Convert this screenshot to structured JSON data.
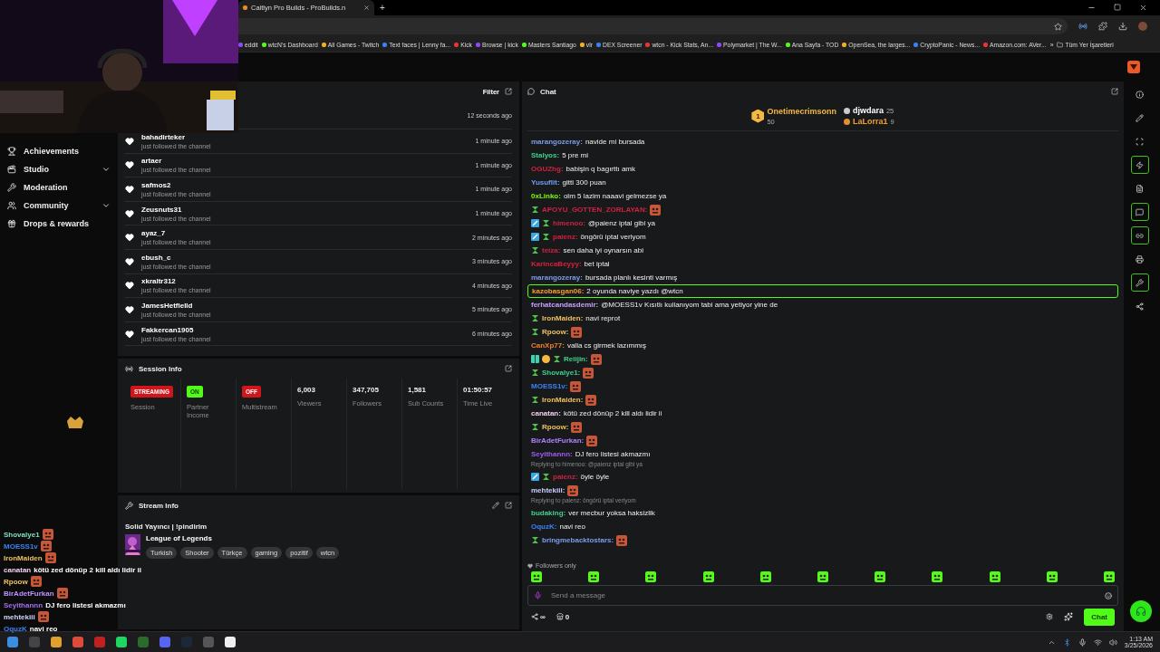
{
  "browser": {
    "tab_title": "Caitlyn Pro Builds - ProBuilds.n",
    "new_tab": "+",
    "bookmarks": [
      "eddit",
      "wtcN's Dashboard",
      "All Games - Twitch",
      "Text faces | Lenny fa...",
      "Kick",
      "Browse | kick",
      "Masters Santiago",
      "vlr",
      "DEX Screener",
      "wtcn - Kick Stats, An...",
      "Polymarket | The W...",
      "Ana Sayfa - TOD",
      "OpenSea, the larges...",
      "CryptoPanic - News...",
      "Amazon.com: AVer..."
    ],
    "more": "»",
    "all_bookmarks": "Tüm Yer İşaretleri"
  },
  "sidebar": {
    "items": [
      {
        "label": "Achievements",
        "expandable": false
      },
      {
        "label": "Studio",
        "expandable": true
      },
      {
        "label": "Moderation",
        "expandable": false
      },
      {
        "label": "Community",
        "expandable": true
      },
      {
        "label": "Drops & rewards",
        "expandable": false
      }
    ]
  },
  "stream_overlay_chat": [
    {
      "name": "Shovalye1",
      "color": "#7fe0c0",
      "emote": true
    },
    {
      "name": "MOESS1v",
      "color": "#3b82f6",
      "emote": true
    },
    {
      "name": "IronMaiden",
      "color": "#f0c060",
      "emote": true
    },
    {
      "name": "canatan",
      "color": "#f0d0f0",
      "text": "kötü zed dönüp 2 kill aldı lidir ii"
    },
    {
      "name": "Rpoow",
      "color": "#f0c060",
      "emote": true
    },
    {
      "name": "BirAdetFurkan",
      "color": "#c090ff",
      "emote": true
    },
    {
      "name": "Seyithannn",
      "color": "#a070f0",
      "text": "DJ fero listesi akmazmı"
    },
    {
      "name": "mehtekiii",
      "color": "#d0d8ff",
      "emote": true
    },
    {
      "name": "OquzK",
      "color": "#3b82f6",
      "text": "navi reo"
    }
  ],
  "activity": {
    "filter": "Filter",
    "latest_time": "12 seconds ago",
    "items": [
      {
        "name": "bahadirteker",
        "action": "just followed the channel",
        "time": "1 minute ago"
      },
      {
        "name": "artaer",
        "action": "just followed the channel",
        "time": "1 minute ago"
      },
      {
        "name": "safmos2",
        "action": "just followed the channel",
        "time": "1 minute ago"
      },
      {
        "name": "Zeusnuts31",
        "action": "just followed the channel",
        "time": "1 minute ago"
      },
      {
        "name": "ayaz_7",
        "action": "just followed the channel",
        "time": "2 minutes ago"
      },
      {
        "name": "ebush_c",
        "action": "just followed the channel",
        "time": "3 minutes ago"
      },
      {
        "name": "xkraltr312",
        "action": "just followed the channel",
        "time": "4 minutes ago"
      },
      {
        "name": "JamesHetfielld",
        "action": "just followed the channel",
        "time": "5 minutes ago"
      },
      {
        "name": "Fakkercan1905",
        "action": "just followed the channel",
        "time": "6 minutes ago"
      }
    ]
  },
  "session_info": {
    "title": "Session Info",
    "stats": [
      {
        "kind": "badge",
        "value": "STREAMING",
        "color": "#d0161b",
        "label": "Session"
      },
      {
        "kind": "badge",
        "value": "ON",
        "color": "#53fc18",
        "label": "Partner Income"
      },
      {
        "kind": "badge",
        "value": "OFF",
        "color": "#d0161b",
        "label": "Multistream"
      },
      {
        "kind": "number",
        "value": "6,003",
        "label": "Viewers"
      },
      {
        "kind": "number",
        "value": "347,705",
        "label": "Followers"
      },
      {
        "kind": "number",
        "value": "1,581",
        "label": "Sub Counts"
      },
      {
        "kind": "number",
        "value": "01:50:57",
        "label": "Time Live"
      }
    ]
  },
  "stream_info": {
    "title": "Stream Info",
    "stream_title": "Solid Yayıncı | !pindirim",
    "category": "League of Legends",
    "tags": [
      "Turkish",
      "Shooter",
      "Türkçe",
      "gaming",
      "pozitif",
      "wtcn"
    ]
  },
  "chat": {
    "title": "Chat",
    "leaderboard": [
      {
        "kind": "top",
        "rank": "1",
        "name": "Onetimecrimsonn",
        "points": "50",
        "color": "#f5b942"
      },
      {
        "kind": "runner",
        "name": "djwdara",
        "points": "25",
        "color": "#ffffff"
      },
      {
        "kind": "runner",
        "name": "LaLorra1",
        "points": "9",
        "color": "#f0a030"
      }
    ],
    "messages": [
      {
        "name": "marangozeray:",
        "color": "#7b9cf0",
        "text": "navide mi bursada"
      },
      {
        "name": "Stalyos:",
        "color": "#3fd18c",
        "text": "5 pre mi"
      },
      {
        "name": "OGUZhg:",
        "color": "#d0223f",
        "text": "babişin q bagırttı amk"
      },
      {
        "name": "Yusuflit:",
        "color": "#6f9ef5",
        "text": "gitti 300 puan"
      },
      {
        "name": "0xLinko:",
        "color": "#7cfc00",
        "text": "olm 5 lazim naaavi gelmezse ya"
      },
      {
        "name": "APOYU_GOTTEN_ZORLAYAN:",
        "color": "#d0223f",
        "badges": [
          {
            "kind": "sub"
          }
        ],
        "emote": true
      },
      {
        "name": "himenoo:",
        "color": "#d0223f",
        "badges": [
          {
            "kind": "mod"
          },
          {
            "kind": "sub"
          }
        ],
        "text": "@paienz iptal gibi ya"
      },
      {
        "name": "paienz:",
        "color": "#d0223f",
        "badges": [
          {
            "kind": "mod"
          },
          {
            "kind": "sub"
          }
        ],
        "text": "öngörü iptal veriyom"
      },
      {
        "name": "teiza:",
        "color": "#d0223f",
        "badges": [
          {
            "kind": "sub"
          }
        ],
        "text": "sen daha iyi oynarsın abi"
      },
      {
        "name": "KarincaBeyyy:",
        "color": "#d0223f",
        "text": "bet iptal"
      },
      {
        "name": "marangozeray:",
        "color": "#7b9cf0",
        "text": "bursada planlı kesinti varmış"
      },
      {
        "name": "kazobasgan06:",
        "color": "#f0a030",
        "text": "2 oyunda naviye yazdı @wtcn",
        "highlighted": true
      },
      {
        "name": "ferhatcandasdemir:",
        "color": "#c9a0ff",
        "text": "@MOESS1v Kısıtlı kullanıyom tabi ama yetiyor yine de"
      },
      {
        "name": "IronMaiden:",
        "color": "#f0c060",
        "badges": [
          {
            "kind": "sub"
          }
        ],
        "text": "navi reprot"
      },
      {
        "name": "Rpoow:",
        "color": "#f0c060",
        "badges": [
          {
            "kind": "sub"
          }
        ],
        "emote": true
      },
      {
        "name": "CanXp77:",
        "color": "#f08030",
        "text": "valla cs girmek lazımmış"
      },
      {
        "name": "Reiijin:",
        "color": "#3fd18c",
        "badges": [
          {
            "kind": "gift"
          },
          {
            "kind": "gold"
          },
          {
            "kind": "sub"
          }
        ],
        "emote": true
      },
      {
        "name": "Shovalye1:",
        "color": "#3fd18c",
        "badges": [
          {
            "kind": "sub"
          }
        ],
        "emote": true
      },
      {
        "name": "MOESS1v:",
        "color": "#3b82f6",
        "emote": true
      },
      {
        "name": "IronMaiden:",
        "color": "#f0c060",
        "badges": [
          {
            "kind": "sub"
          }
        ],
        "emote": true
      },
      {
        "name": "canatan:",
        "color": "#f0d0f0",
        "text": "kötü zed dönüp 2 kill aldı lidir ii"
      },
      {
        "name": "Rpoow:",
        "color": "#f0c060",
        "badges": [
          {
            "kind": "sub"
          }
        ],
        "emote": true
      },
      {
        "name": "BirAdetFurkan:",
        "color": "#b080ff",
        "emote": true
      },
      {
        "name": "Seyithannn:",
        "color": "#9b5cf0",
        "text": "DJ fero listesi akmazmı"
      },
      {
        "reply": "Replying to himenoo: @paienz iptal gibi ya",
        "name": "paienz:",
        "color": "#d0223f",
        "badges": [
          {
            "kind": "mod"
          },
          {
            "kind": "sub"
          }
        ],
        "text": "öyle öyle"
      },
      {
        "name": "mehtekiii:",
        "color": "#c9d0ff",
        "emote": true
      },
      {
        "reply": "Replying to paienz: öngörü iptal veriyom",
        "name": "budaking:",
        "color": "#3fd18c",
        "text": "ver mecbur yoksa haksizlik"
      },
      {
        "name": "OquzK:",
        "color": "#3b82f6",
        "text": "navi reo"
      },
      {
        "name": "bringmebacktostars:",
        "color": "#7b9cf0",
        "badges": [
          {
            "kind": "sub"
          }
        ],
        "emote": true
      }
    ],
    "mode": "Followers only",
    "input": {
      "placeholder": "Send a message"
    },
    "points": "∞",
    "shop_count": "0",
    "send": "Chat"
  },
  "rail": [
    {
      "kind": "info",
      "highlighted": false
    },
    {
      "kind": "pencil",
      "highlighted": false
    },
    {
      "kind": "focus",
      "highlighted": false
    },
    {
      "kind": "bolt",
      "highlighted": true
    },
    {
      "kind": "doc",
      "highlighted": false
    },
    {
      "kind": "chat",
      "highlighted": true
    },
    {
      "kind": "link",
      "highlighted": true
    },
    {
      "kind": "print",
      "highlighted": false
    },
    {
      "kind": "wrench",
      "highlighted": true
    },
    {
      "kind": "nodes",
      "highlighted": false
    }
  ],
  "taskbar": {
    "time": "1:13 AM",
    "date": "3/25/2026"
  }
}
